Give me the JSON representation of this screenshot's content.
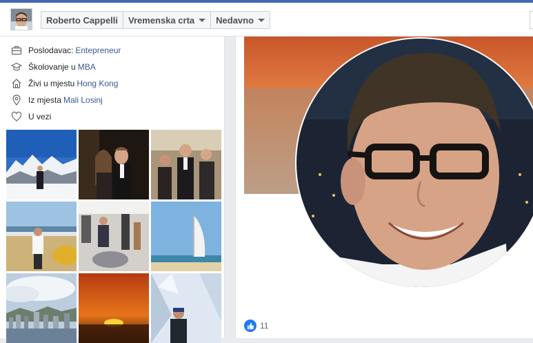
{
  "header": {
    "breadcrumbs": [
      {
        "label": "Roberto Cappelli",
        "has_caret": false
      },
      {
        "label": "Vremenska crta",
        "has_caret": true
      },
      {
        "label": "Nedavno",
        "has_caret": true
      }
    ]
  },
  "intro": {
    "items": [
      {
        "icon": "briefcase-icon",
        "prefix": "Poslodavac:",
        "link": "Entepreneur"
      },
      {
        "icon": "graduation-cap-icon",
        "prefix": "Školovanje u",
        "link": "MBA"
      },
      {
        "icon": "home-icon",
        "prefix": "Živi u mjestu",
        "link": "Hong Kong"
      },
      {
        "icon": "location-pin-icon",
        "prefix": "Iz mjesta",
        "link": "Mali Losinj"
      },
      {
        "icon": "heart-icon",
        "prefix": "U vezi",
        "link": ""
      }
    ]
  },
  "photos": [
    {
      "name": "mountain-snow-photo"
    },
    {
      "name": "couple-evening-photo"
    },
    {
      "name": "group-party-photo"
    },
    {
      "name": "seaplane-photo"
    },
    {
      "name": "showroom-photo"
    },
    {
      "name": "burj-al-arab-photo"
    },
    {
      "name": "hong-kong-skyline-photo"
    },
    {
      "name": "sunset-photo"
    },
    {
      "name": "snowy-trees-photo"
    }
  ],
  "post": {
    "like_count": "11"
  },
  "colors": {
    "brand_blue": "#4267b2",
    "link_blue": "#385898",
    "like_blue": "#2078f4"
  }
}
